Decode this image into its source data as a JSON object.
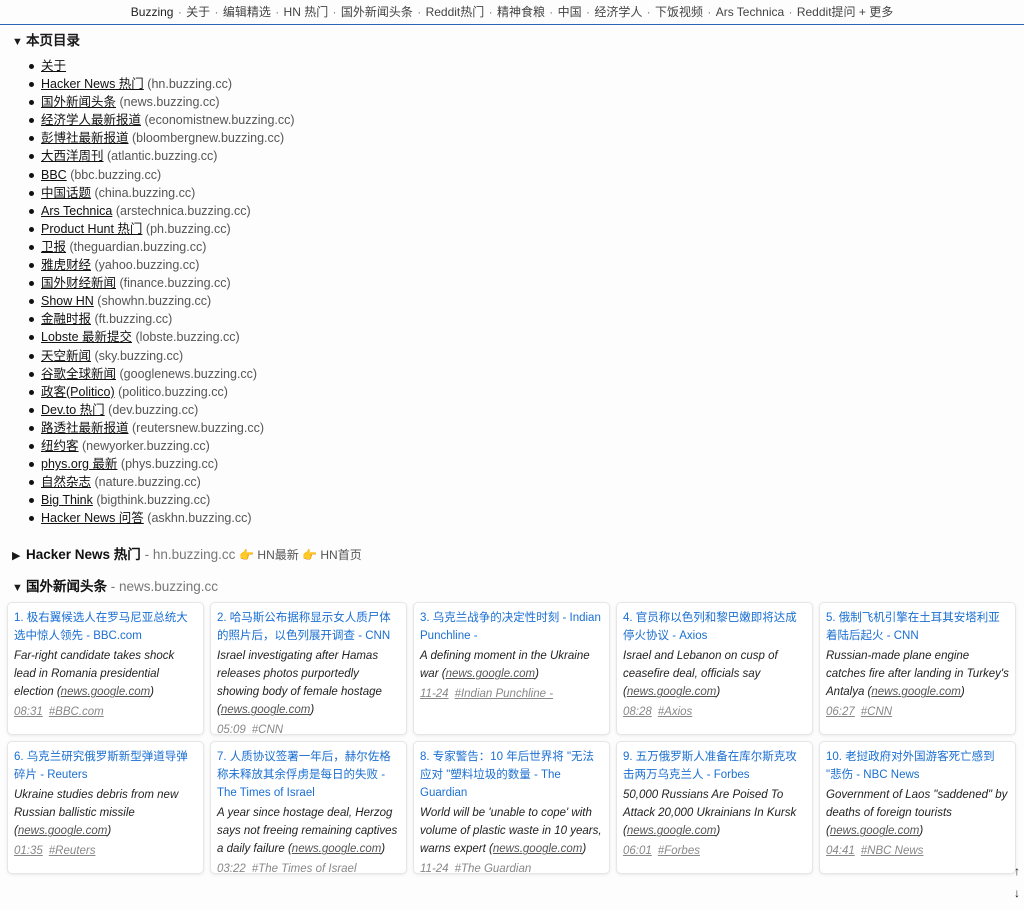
{
  "topnav": {
    "brand": "Buzzing",
    "items": [
      "关于",
      "编辑精选",
      "HN 热门",
      "国外新闻头条",
      "Reddit热门",
      "精神食粮",
      "中国",
      "经济学人",
      "下饭视频",
      "Ars Technica",
      "Reddit提问"
    ],
    "more": "+ 更多"
  },
  "toc": {
    "summary": "本页目录",
    "items": [
      {
        "label": "关于",
        "domain": ""
      },
      {
        "label": "Hacker News 热门",
        "domain": "(hn.buzzing.cc)"
      },
      {
        "label": "国外新闻头条",
        "domain": "(news.buzzing.cc)"
      },
      {
        "label": "经济学人最新报道",
        "domain": "(economistnew.buzzing.cc)"
      },
      {
        "label": "彭博社最新报道",
        "domain": "(bloombergnew.buzzing.cc)"
      },
      {
        "label": "大西洋周刊",
        "domain": "(atlantic.buzzing.cc)"
      },
      {
        "label": "BBC",
        "domain": "(bbc.buzzing.cc)"
      },
      {
        "label": "中国话题",
        "domain": "(china.buzzing.cc)"
      },
      {
        "label": "Ars Technica",
        "domain": "(arstechnica.buzzing.cc)"
      },
      {
        "label": "Product Hunt 热门",
        "domain": "(ph.buzzing.cc)"
      },
      {
        "label": "卫报",
        "domain": "(theguardian.buzzing.cc)"
      },
      {
        "label": "雅虎财经",
        "domain": "(yahoo.buzzing.cc)"
      },
      {
        "label": "国外财经新闻",
        "domain": "(finance.buzzing.cc)"
      },
      {
        "label": "Show HN",
        "domain": "(showhn.buzzing.cc)"
      },
      {
        "label": "金融时报",
        "domain": "(ft.buzzing.cc)"
      },
      {
        "label": "Lobste 最新提交",
        "domain": "(lobste.buzzing.cc)"
      },
      {
        "label": "天空新闻",
        "domain": "(sky.buzzing.cc)"
      },
      {
        "label": "谷歌全球新闻",
        "domain": "(googlenews.buzzing.cc)"
      },
      {
        "label": "政客(Politico)",
        "domain": "(politico.buzzing.cc)"
      },
      {
        "label": "Dev.to 热门",
        "domain": "(dev.buzzing.cc)"
      },
      {
        "label": "路透社最新报道",
        "domain": "(reutersnew.buzzing.cc)"
      },
      {
        "label": "纽约客",
        "domain": "(newyorker.buzzing.cc)"
      },
      {
        "label": "phys.org 最新",
        "domain": "(phys.buzzing.cc)"
      },
      {
        "label": "自然杂志",
        "domain": "(nature.buzzing.cc)"
      },
      {
        "label": "Big Think",
        "domain": "(bigthink.buzzing.cc)"
      },
      {
        "label": "Hacker News 问答",
        "domain": "(askhn.buzzing.cc)"
      }
    ]
  },
  "hn_section": {
    "name": "Hacker News 热门",
    "domain": "- hn.buzzing.cc",
    "links": "👉 HN最新 👉 HN首页"
  },
  "news_section": {
    "name": "国外新闻头条",
    "domain": "- news.buzzing.cc",
    "cards": [
      {
        "title": "1. 极右翼候选人在罗马尼亚总统大选中惊人领先 - BBC.com",
        "excerpt": "Far-right candidate takes shock lead in Romania presidential election",
        "src": "news.google.com",
        "time": "08:31",
        "tag": "#BBC.com"
      },
      {
        "title": "2. 哈马斯公布据称显示女人质尸体的照片后，以色列展开调查 - CNN",
        "excerpt": "Israel investigating after Hamas releases photos purportedly showing body of female hostage",
        "src": "news.google.com",
        "time": "05:09",
        "tag": "#CNN"
      },
      {
        "title": "3. 乌克兰战争的决定性时刻 - Indian Punchline -",
        "excerpt": "A defining moment in the Ukraine war",
        "src": "news.google.com",
        "time": "11-24",
        "tag": "#Indian Punchline -"
      },
      {
        "title": "4. 官员称以色列和黎巴嫩即将达成停火协议 - Axios",
        "excerpt": "Israel and Lebanon on cusp of ceasefire deal, officials say",
        "src": "news.google.com",
        "time": "08:28",
        "tag": "#Axios"
      },
      {
        "title": "5. 俄制飞机引擎在土耳其安塔利亚着陆后起火 - CNN",
        "excerpt": "Russian-made plane engine catches fire after landing in Turkey's Antalya",
        "src": "news.google.com",
        "time": "06:27",
        "tag": "#CNN"
      },
      {
        "title": "6. 乌克兰研究俄罗斯新型弹道导弹碎片 - Reuters",
        "excerpt": "Ukraine studies debris from new Russian ballistic missile",
        "src": "news.google.com",
        "time": "01:35",
        "tag": "#Reuters"
      },
      {
        "title": "7. 人质协议签署一年后，赫尔佐格称未释放其余俘虏是每日的失败 - The Times of Israel",
        "excerpt": "A year since hostage deal, Herzog says not freeing remaining captives a daily failure",
        "src": "news.google.com",
        "time": "03:22",
        "tag": "#The Times of Israel"
      },
      {
        "title": "8. 专家警告：10 年后世界将 \"无法应对 \"塑料垃圾的数量 - The Guardian",
        "excerpt": "World will be 'unable to cope' with volume of plastic waste in 10 years, warns expert",
        "src": "news.google.com",
        "time": "11-24",
        "tag": "#The Guardian"
      },
      {
        "title": "9. 五万俄罗斯人准备在库尔斯克攻击两万乌克兰人 - Forbes",
        "excerpt": "50,000 Russians Are Poised To Attack 20,000 Ukrainians In Kursk",
        "src": "news.google.com",
        "time": "06:01",
        "tag": "#Forbes"
      },
      {
        "title": "10. 老挝政府对外国游客死亡感到 \"悲伤 - NBC News",
        "excerpt": "Government of Laos \"saddened\" by deaths of foreign tourists",
        "src": "news.google.com",
        "time": "04:41",
        "tag": "#NBC News"
      }
    ]
  },
  "scroll": {
    "up": "↑",
    "down": "↓"
  }
}
